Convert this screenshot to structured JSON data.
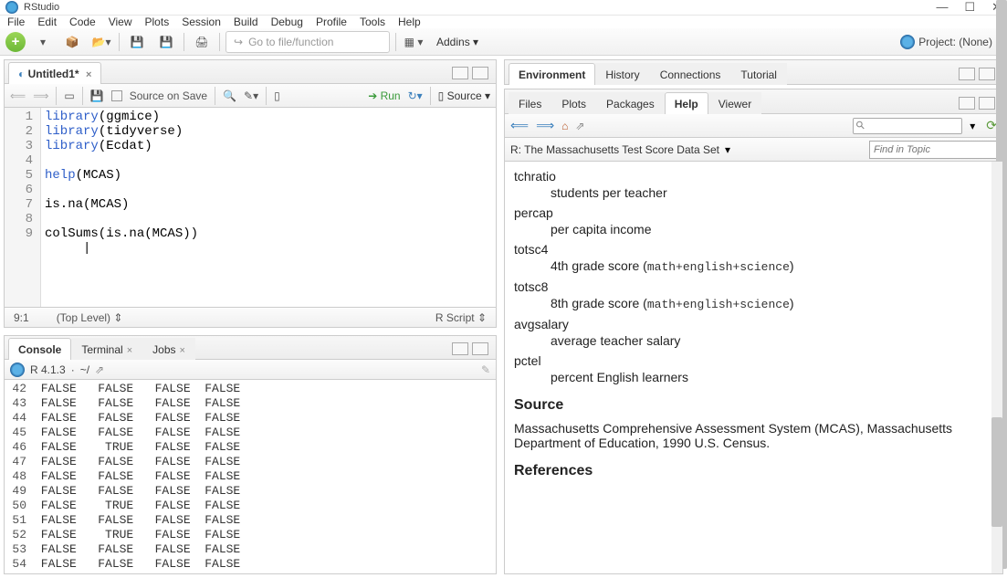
{
  "window": {
    "title": "RStudio"
  },
  "menubar": [
    "File",
    "Edit",
    "Code",
    "View",
    "Plots",
    "Session",
    "Build",
    "Debug",
    "Profile",
    "Tools",
    "Help"
  ],
  "toolbar": {
    "goto_placeholder": "Go to file/function",
    "addins_label": "Addins",
    "project_label": "Project: (None)"
  },
  "editor": {
    "tab_title": "Untitled1*",
    "save_on_source": "Source on Save",
    "run_label": "Run",
    "source_label": "Source",
    "lines": [
      "library(ggmice)",
      "library(tidyverse)",
      "library(Ecdat)",
      "",
      "help(MCAS)",
      "",
      "is.na(MCAS)",
      "",
      "colSums(is.na(MCAS))"
    ],
    "status_pos": "9:1",
    "status_scope": "(Top Level)",
    "status_lang": "R Script"
  },
  "console": {
    "tabs": [
      "Console",
      "Terminal",
      "Jobs"
    ],
    "version": "R 4.1.3",
    "path": "~/",
    "rows": [
      {
        "n": "42",
        "v": " FALSE   FALSE   FALSE  FALSE"
      },
      {
        "n": "43",
        "v": " FALSE   FALSE   FALSE  FALSE"
      },
      {
        "n": "44",
        "v": " FALSE   FALSE   FALSE  FALSE"
      },
      {
        "n": "45",
        "v": " FALSE   FALSE   FALSE  FALSE"
      },
      {
        "n": "46",
        "v": " FALSE    TRUE   FALSE  FALSE"
      },
      {
        "n": "47",
        "v": " FALSE   FALSE   FALSE  FALSE"
      },
      {
        "n": "48",
        "v": " FALSE   FALSE   FALSE  FALSE"
      },
      {
        "n": "49",
        "v": " FALSE   FALSE   FALSE  FALSE"
      },
      {
        "n": "50",
        "v": " FALSE    TRUE   FALSE  FALSE"
      },
      {
        "n": "51",
        "v": " FALSE   FALSE   FALSE  FALSE"
      },
      {
        "n": "52",
        "v": " FALSE    TRUE   FALSE  FALSE"
      },
      {
        "n": "53",
        "v": " FALSE   FALSE   FALSE  FALSE"
      },
      {
        "n": "54",
        "v": " FALSE   FALSE   FALSE  FALSE"
      }
    ]
  },
  "right_upper_tabs": [
    "Environment",
    "History",
    "Connections",
    "Tutorial"
  ],
  "right_lower_tabs": [
    "Files",
    "Plots",
    "Packages",
    "Help",
    "Viewer"
  ],
  "help": {
    "topic": "R: The Massachusetts Test Score Data Set",
    "find_placeholder": "Find in Topic",
    "entries": [
      {
        "term": "tchratio",
        "desc": "students per teacher"
      },
      {
        "term": "percap",
        "desc": "per capita income"
      },
      {
        "term": "totsc4",
        "desc": "4th grade score (",
        "mono": "math+english+science",
        "tail": ")"
      },
      {
        "term": "totsc8",
        "desc": "8th grade score (",
        "mono": "math+english+science",
        "tail": ")"
      },
      {
        "term": "avgsalary",
        "desc": "average teacher salary"
      },
      {
        "term": "pctel",
        "desc": "percent English learners"
      }
    ],
    "source_heading": "Source",
    "source_text": "Massachusetts Comprehensive Assessment System (MCAS), Massachusetts Department of Education, 1990 U.S. Census.",
    "refs_heading": "References"
  }
}
